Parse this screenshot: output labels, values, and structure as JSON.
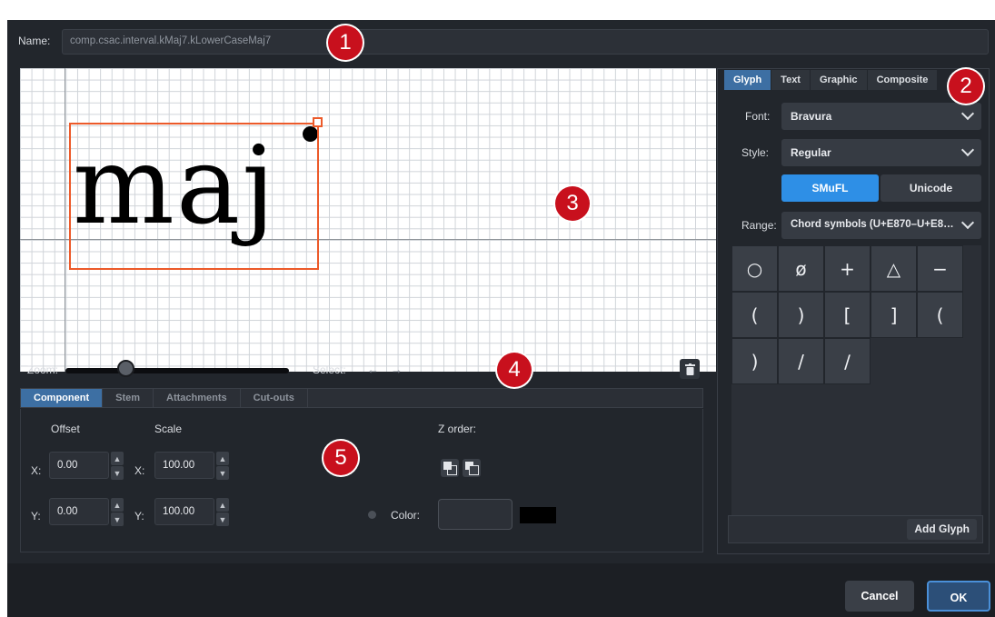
{
  "dialog": {
    "name_label": "Name:",
    "name_value": "comp.csac.interval.kMaj7.kLowerCaseMaj7"
  },
  "canvas": {
    "glyph_text": "maj"
  },
  "toolbar": {
    "zoom_label": "Zoom:",
    "select_label": "Select:",
    "prev_arrow": "←",
    "next_arrow": "→",
    "zoom_level": 0.27
  },
  "component_tabs": [
    "Component",
    "Stem",
    "Attachments",
    "Cut-outs"
  ],
  "component": {
    "offset_label": "Offset",
    "scale_label": "Scale",
    "zorder_label": "Z order:",
    "x_label": "X:",
    "y_label": "Y:",
    "offset_x": "0.00",
    "offset_y": "0.00",
    "scale_x": "100.00",
    "scale_y": "100.00",
    "color_label": "Color:",
    "color_value": "#000000"
  },
  "right_tabs": [
    "Glyph",
    "Text",
    "Graphic",
    "Composite"
  ],
  "glyph_panel": {
    "font_label": "Font:",
    "font_value": "Bravura",
    "style_label": "Style:",
    "style_value": "Regular",
    "seg_smufl": "SMuFL",
    "seg_unicode": "Unicode",
    "range_label": "Range:",
    "range_value": "Chord symbols (U+E870–U+E8…",
    "glyphs": [
      "○",
      "ø",
      "+",
      "△",
      "−",
      "(",
      ")",
      "[",
      "]",
      "(",
      ")",
      "/",
      "∕"
    ],
    "add_glyph_label": "Add Glyph"
  },
  "footer": {
    "cancel_label": "Cancel",
    "ok_label": "OK"
  },
  "callouts": [
    "1",
    "2",
    "3",
    "4",
    "5"
  ],
  "colors": {
    "accent": "#3d6fa3",
    "smufl_active": "#2e8fe6",
    "selection": "#ec5a2a",
    "callout": "#c8101d"
  }
}
